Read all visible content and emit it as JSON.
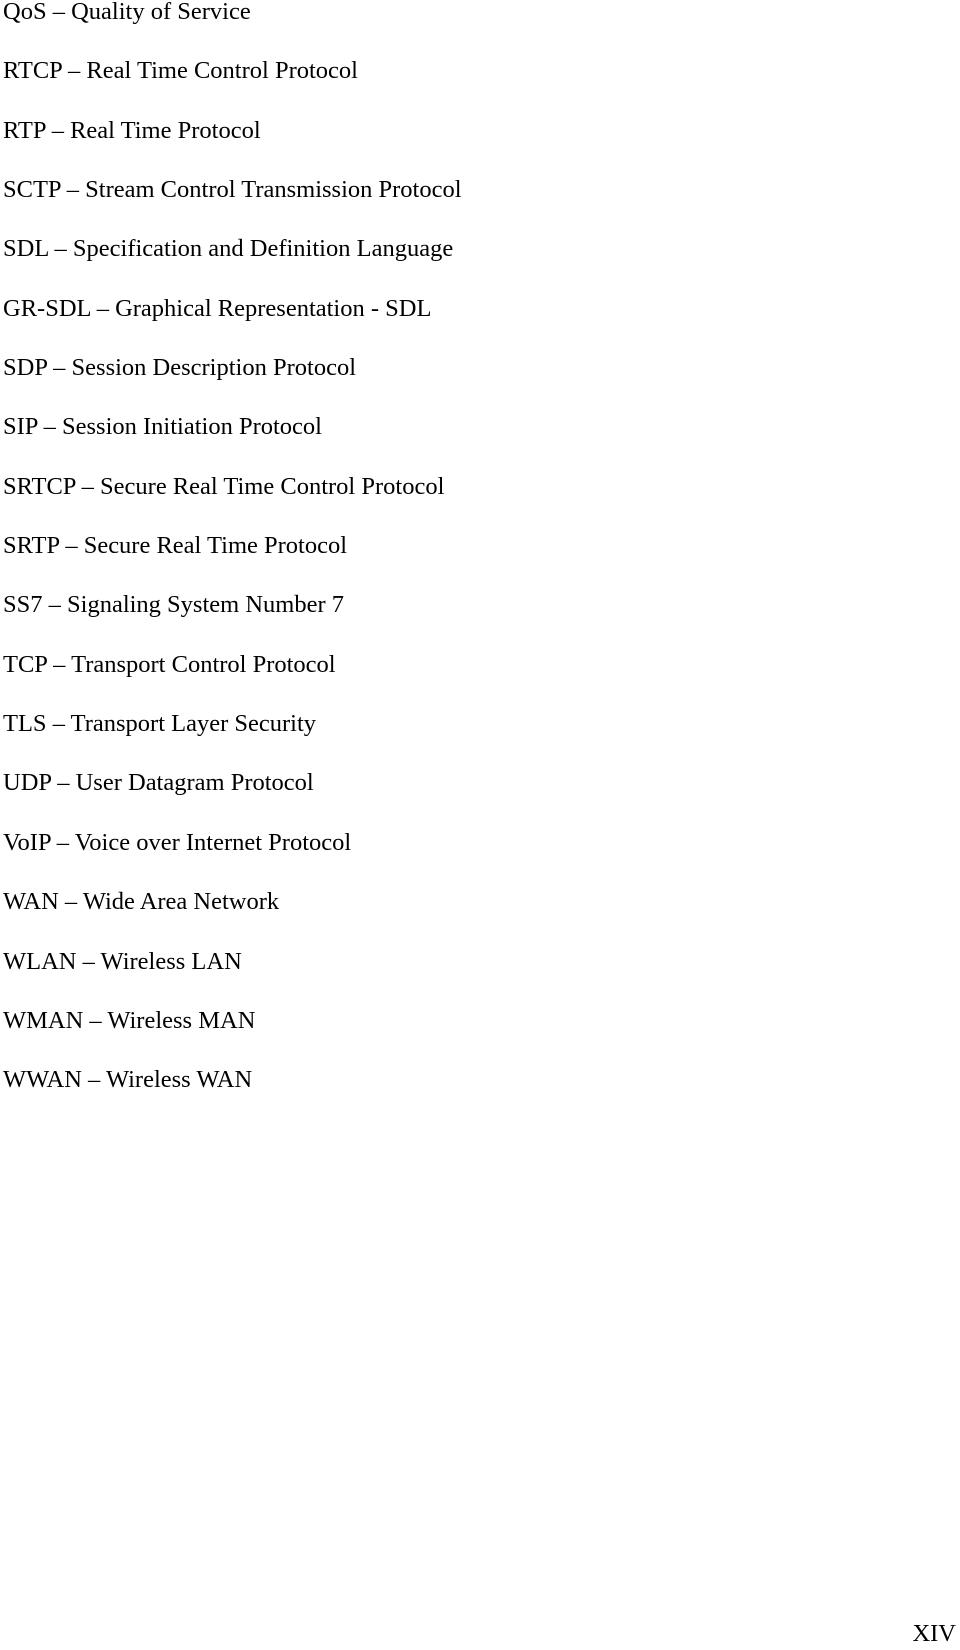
{
  "abbreviations": [
    {
      "abbr": "QoS",
      "definition": "Quality of Service"
    },
    {
      "abbr": "RTCP",
      "definition": "Real Time Control Protocol"
    },
    {
      "abbr": "RTP",
      "definition": "Real Time Protocol"
    },
    {
      "abbr": "SCTP",
      "definition": "Stream Control Transmission Protocol"
    },
    {
      "abbr": "SDL",
      "definition": "Specification and Definition Language"
    },
    {
      "abbr": "GR-SDL",
      "definition": "Graphical Representation - SDL"
    },
    {
      "abbr": "SDP",
      "definition": "Session Description Protocol"
    },
    {
      "abbr": "SIP",
      "definition": "Session Initiation Protocol"
    },
    {
      "abbr": "SRTCP",
      "definition": "Secure Real Time Control Protocol"
    },
    {
      "abbr": "SRTP",
      "definition": "Secure Real Time Protocol"
    },
    {
      "abbr": "SS7",
      "definition": "Signaling System Number 7"
    },
    {
      "abbr": "TCP",
      "definition": "Transport Control Protocol"
    },
    {
      "abbr": "TLS",
      "definition": "Transport Layer Security"
    },
    {
      "abbr": "UDP",
      "definition": "User Datagram Protocol"
    },
    {
      "abbr": "VoIP",
      "definition": "Voice over Internet Protocol"
    },
    {
      "abbr": "WAN",
      "definition": "Wide Area Network"
    },
    {
      "abbr": "WLAN",
      "definition": "Wireless LAN"
    },
    {
      "abbr": "WMAN",
      "definition": "Wireless MAN"
    },
    {
      "abbr": "WWAN",
      "definition": "Wireless WAN"
    }
  ],
  "separator": " – ",
  "page_number": "XIV"
}
